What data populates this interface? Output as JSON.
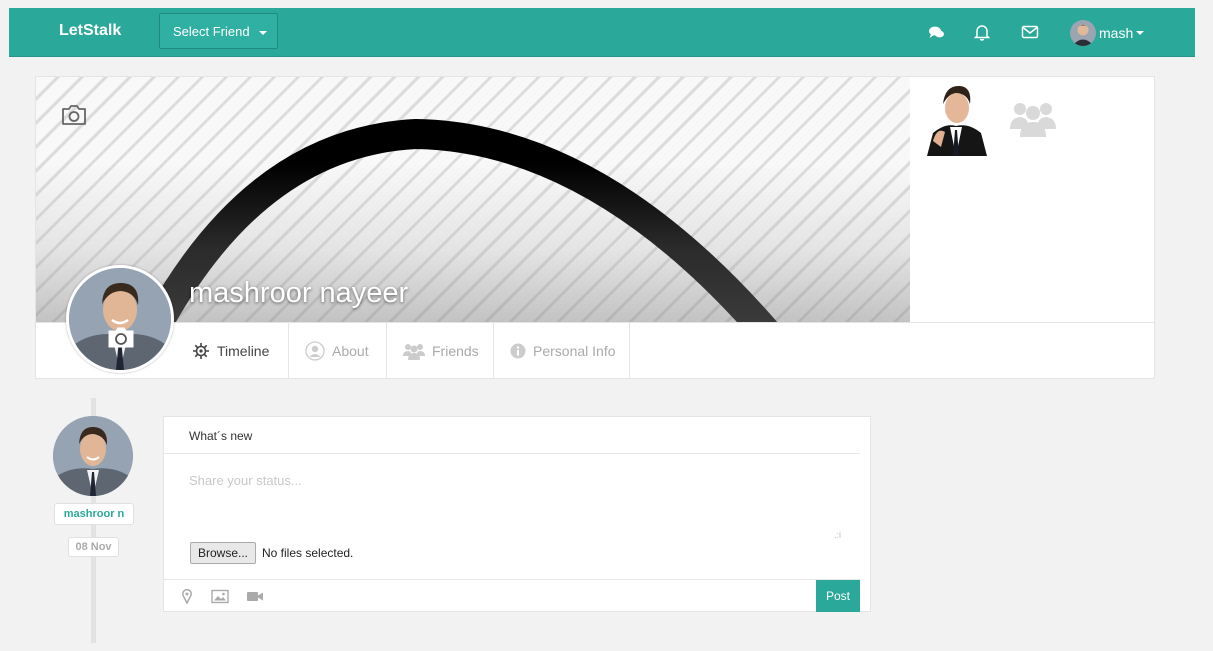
{
  "navbar": {
    "brand": "LetStalk",
    "select_friend": "Select Friend",
    "username": "mash"
  },
  "profile": {
    "name": "mashroor nayeer",
    "tabs": [
      {
        "label": "Timeline"
      },
      {
        "label": "About"
      },
      {
        "label": "Friends"
      },
      {
        "label": "Personal Info"
      }
    ]
  },
  "timeline": {
    "author": "mashroor n",
    "date": "08 Nov"
  },
  "post": {
    "heading": "What´s new",
    "placeholder": "Share your status...",
    "browse_label": "Browse...",
    "file_status": "No files selected.",
    "submit_label": "Post"
  },
  "colors": {
    "accent": "#2aa89a"
  }
}
